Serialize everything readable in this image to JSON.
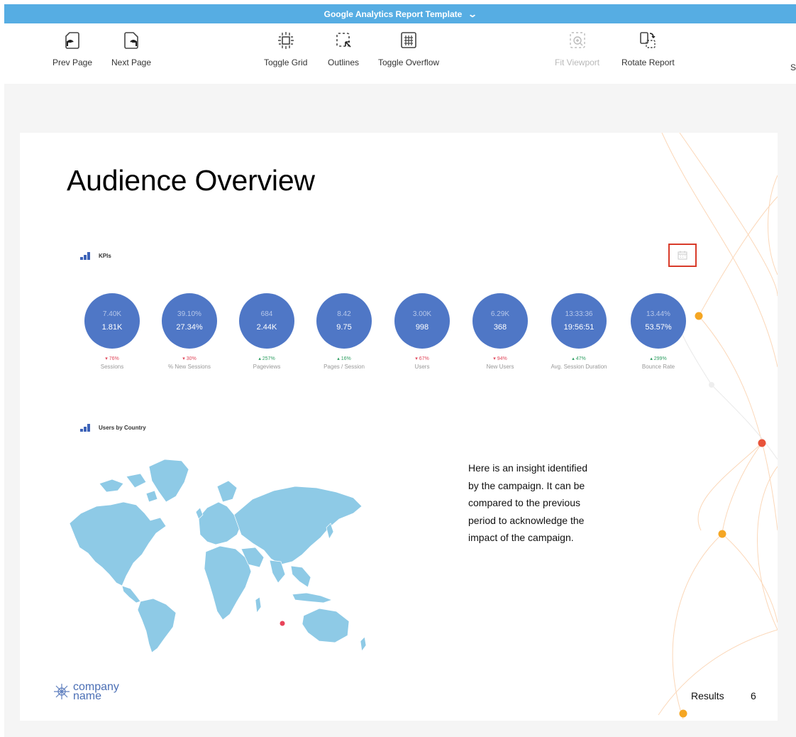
{
  "app": {
    "title": "Google Analytics Report Template",
    "title_chevron_icon": "chevron-down-icon"
  },
  "toolbar": {
    "prev_page": "Prev Page",
    "next_page": "Next Page",
    "toggle_grid": "Toggle Grid",
    "outlines": "Outlines",
    "toggle_overflow": "Toggle Overflow",
    "fit_viewport": "Fit Viewport",
    "rotate_report": "Rotate Report",
    "truncated": "S"
  },
  "report": {
    "title": "Audience Overview",
    "kpi_section": "KPIs",
    "country_section": "Users by Country",
    "insight": "Here is an insight identified by the campaign. It can be compared to the previous period to acknowledge the impact of the campaign.",
    "logo_line1": "company",
    "logo_line2": "name",
    "footer_label": "Results",
    "page_number": "6"
  },
  "kpis": [
    {
      "label": "Sessions",
      "previous": "7.40K",
      "current": "1.81K",
      "change": "▾ 76%",
      "trend": "down"
    },
    {
      "label": "% New Sessions",
      "previous": "39.10%",
      "current": "27.34%",
      "change": "▾ 30%",
      "trend": "down"
    },
    {
      "label": "Pageviews",
      "previous": "684",
      "current": "2.44K",
      "change": "▴ 257%",
      "trend": "up"
    },
    {
      "label": "Pages / Session",
      "previous": "8.42",
      "current": "9.75",
      "change": "▴ 16%",
      "trend": "up"
    },
    {
      "label": "Users",
      "previous": "3.00K",
      "current": "998",
      "change": "▾ 67%",
      "trend": "down"
    },
    {
      "label": "New Users",
      "previous": "6.29K",
      "current": "368",
      "change": "▾ 94%",
      "trend": "down"
    },
    {
      "label": "Avg. Session Duration",
      "previous": "13:33:36",
      "current": "19:56:51",
      "change": "▴ 47%",
      "trend": "up"
    },
    {
      "label": "Bounce Rate",
      "previous": "13.44%",
      "current": "53.57%",
      "change": "▴ 299%",
      "trend": "up"
    }
  ],
  "colors": {
    "titlebar": "#56ade3",
    "kpi_circle": "#4f77c6",
    "map_fill": "#8ecae6",
    "trend_up": "#2e9e62",
    "trend_down": "#e0465a",
    "highlight": "#d83b2a",
    "deco_orange": "#f5a623",
    "deco_red": "#e8533a"
  }
}
